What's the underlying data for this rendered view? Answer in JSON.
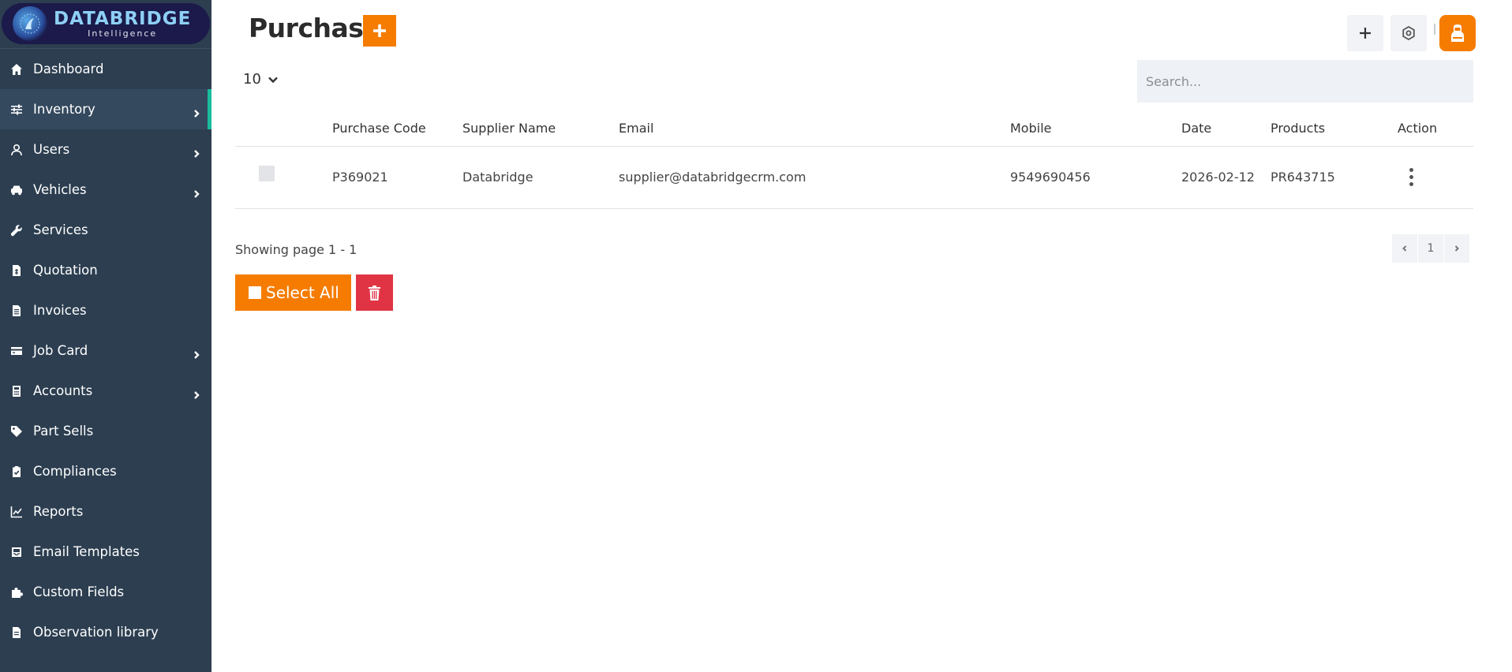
{
  "brand": {
    "title": "DATABRIDGE",
    "subtitle": "Intelligence"
  },
  "sidebar": {
    "items": [
      {
        "label": "Dashboard",
        "icon": "home-icon",
        "has_submenu": false
      },
      {
        "label": "Inventory",
        "icon": "sliders-icon",
        "has_submenu": true,
        "active": true
      },
      {
        "label": "Users",
        "icon": "user-icon",
        "has_submenu": true
      },
      {
        "label": "Vehicles",
        "icon": "car-icon",
        "has_submenu": true
      },
      {
        "label": "Services",
        "icon": "wrench-icon",
        "has_submenu": false
      },
      {
        "label": "Quotation",
        "icon": "file-dollar-icon",
        "has_submenu": false
      },
      {
        "label": "Invoices",
        "icon": "file-text-icon",
        "has_submenu": false
      },
      {
        "label": "Job Card",
        "icon": "credit-card-icon",
        "has_submenu": true
      },
      {
        "label": "Accounts",
        "icon": "calculator-icon",
        "has_submenu": true
      },
      {
        "label": "Part Sells",
        "icon": "tag-icon",
        "has_submenu": false
      },
      {
        "label": "Compliances",
        "icon": "clipboard-check-icon",
        "has_submenu": false
      },
      {
        "label": "Reports",
        "icon": "chart-line-icon",
        "has_submenu": false
      },
      {
        "label": "Email Templates",
        "icon": "inbox-icon",
        "has_submenu": false
      },
      {
        "label": "Custom Fields",
        "icon": "puzzle-icon",
        "has_submenu": false
      },
      {
        "label": "Observation library",
        "icon": "file-icon",
        "has_submenu": false
      }
    ]
  },
  "header": {
    "title": "Purchase"
  },
  "controls": {
    "page_size": "10",
    "search_placeholder": "Search..."
  },
  "table": {
    "columns": [
      "",
      "Purchase Code",
      "Supplier Name",
      "Email",
      "Mobile",
      "Date",
      "Products",
      "Action"
    ],
    "rows": [
      {
        "purchase_code": "P369021",
        "supplier_name": "Databridge",
        "email": "supplier@databridgecrm.com",
        "mobile": "9549690456",
        "date": "2026-02-12",
        "products": "PR643715"
      }
    ]
  },
  "pagination": {
    "showing": "Showing page 1 - 1",
    "current_page": "1"
  },
  "actions": {
    "select_all_label": "Select All"
  },
  "colors": {
    "accent": "#f57c00",
    "sidebar_bg": "#2c3e50",
    "active_marker": "#1abc9c",
    "danger": "#e03444"
  }
}
